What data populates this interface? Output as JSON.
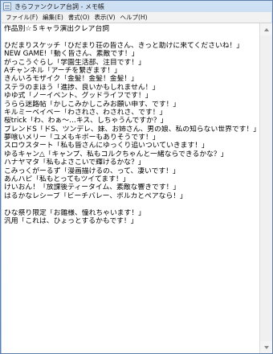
{
  "window": {
    "title": "きらファンクレア台詞 - メモ帳"
  },
  "menu": {
    "items": [
      "ファイル(F)",
      "編集(E)",
      "書式(O)",
      "表示(V)",
      "ヘルプ(H)"
    ]
  },
  "document": {
    "lines": [
      "作品別☆５キャラ演出クレア台詞",
      "",
      "ひだまりスケッチ「ひだまり荘の皆さん、きっと助けに来てくださいね！」",
      "NEW GAME!「動く皆さん、素敵です！」",
      "がっこうぐらし「学園生活部、注目です！」",
      "Aチャンネル「アーチを繋ぎます！」",
      "きんいろモザイク「金髪！金髪！金髪！」",
      "ステラのまほう「進捗、良いかもしれません！」",
      "ゆゆ式「ノーイベント、グッドライフです！」",
      "うらら迷路帖「かしこみかしこみお願い申す、です！」",
      "キルミーベイベー「わされさ、わされさ、です！」",
      "桜trick「わ、わぁ～…キス、しちゃうんですか？」",
      "ブレンドS「ドS、ツンデレ、妹、お姉さん、男の娘、私の知らない世界です！」",
      "夢喰いメリー「ユメもキボーもありそうです！」",
      "スロウスタート「私も皆さんにゆっくり追いついていきます！」",
      "ゆるキャン△「キャンプ、私もコルクちゃんと一緒ならできるかな？」",
      "ハナヤマタ「私もよさこいで輝けるかな？」",
      "こみっくがーるず「漫画描けるの、って、凄いです！」",
      "あんハピ「私もとってもツイてます！」",
      "けいおん！「放課後ティータイム、素敵な響きです！」",
      "はるかなレシーブ「ビーチバレー、ボルカとペアなら！」",
      "",
      "ひな祭り限定「お雛様、憧れちゃいます！」",
      "汎用「これは、ひょっとするかもです！」"
    ]
  },
  "scrollbar": {
    "up_icon": "scroll-up-arrow",
    "down_icon": "scroll-down-arrow"
  }
}
